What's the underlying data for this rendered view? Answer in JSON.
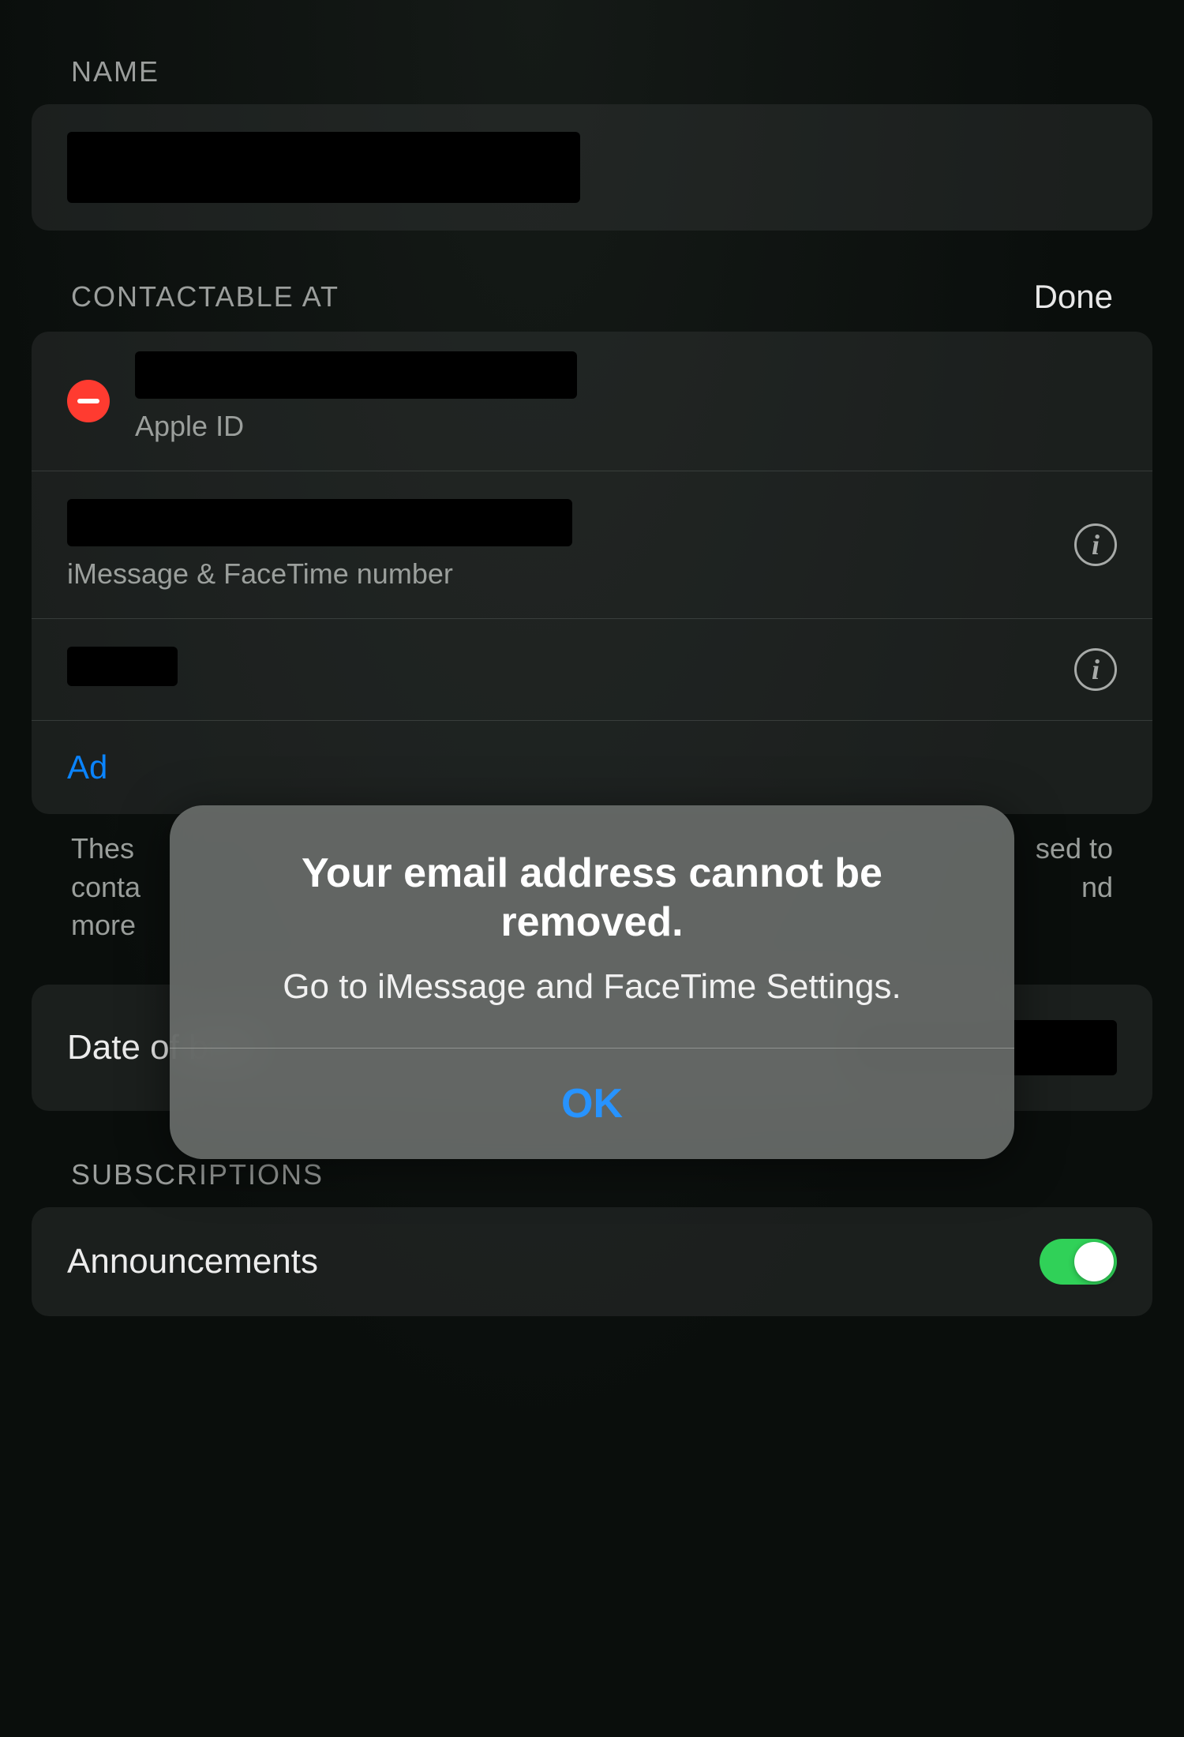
{
  "sections": {
    "name": {
      "header": "NAME"
    },
    "contactable": {
      "header": "CONTACTABLE AT",
      "done_label": "Done",
      "items": [
        {
          "sublabel": "Apple ID"
        },
        {
          "sublabel": "iMessage & FaceTime number"
        },
        {
          "sublabel": ""
        }
      ],
      "add_label": "Ad",
      "footer": "Thes\nconta\nmore",
      "footer_right": "sed to\nnd"
    },
    "dob": {
      "label": "Date of birth"
    },
    "subscriptions": {
      "header": "SUBSCRIPTIONS",
      "items": [
        {
          "label": "Announcements",
          "on": true
        }
      ]
    }
  },
  "alert": {
    "title": "Your email address cannot be removed.",
    "message": "Go to iMessage and FaceTime Settings.",
    "ok_label": "OK"
  }
}
